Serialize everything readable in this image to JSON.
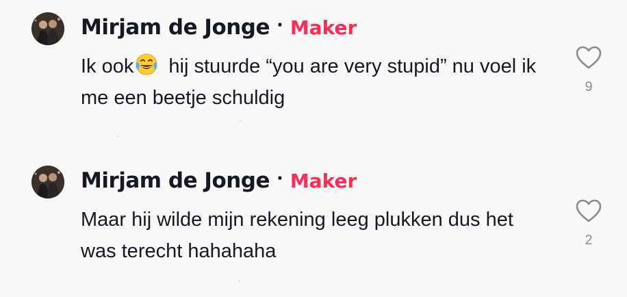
{
  "comments": [
    {
      "username": "Mirjam de Jonge",
      "separator": "·",
      "badge": "Maker",
      "text_before_emoji": "Ik ook",
      "emoji": "face-with-tears-of-joy",
      "text_after_emoji": " hij stuurde “you are very stupid” nu voel ik me een beetje schuldig",
      "likes": "9",
      "icon": "heart-outline-icon"
    },
    {
      "username": "Mirjam de Jonge",
      "separator": "·",
      "badge": "Maker",
      "text": "Maar hij wilde mijn rekening leeg plukken dus het was terecht hahahaha",
      "likes": "2",
      "icon": "heart-outline-icon"
    }
  ],
  "colors": {
    "background": "#f8f8f8",
    "text": "#161823",
    "badge": "#fe2c55",
    "muted": "#8a8b91"
  }
}
